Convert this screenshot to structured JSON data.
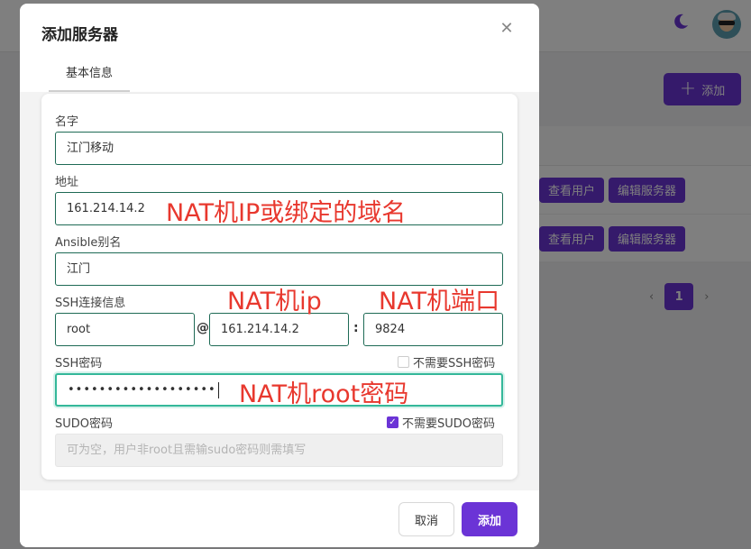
{
  "background": {
    "add_button": "添加",
    "rows": [
      {
        "view_users": "查看用户",
        "edit_server": "编辑服务器"
      },
      {
        "view_users": "查看用户",
        "edit_server": "编辑服务器"
      }
    ],
    "pagination": {
      "prev": "‹",
      "current": "1",
      "next": "›"
    }
  },
  "modal": {
    "title": "添加服务器",
    "tabs": [
      "基本信息"
    ],
    "fields": {
      "name": {
        "label": "名字",
        "value": "江门移动"
      },
      "address": {
        "label": "地址",
        "value": "161.214.14.2"
      },
      "ansible_alias": {
        "label": "Ansible别名",
        "value": "江门"
      },
      "ssh": {
        "label": "SSH连接信息",
        "user": "root",
        "at": "@",
        "host": "161.214.14.2",
        "colon": ":",
        "port": "9824"
      },
      "ssh_password": {
        "label": "SSH密码",
        "value": "•••••••••••••••••••",
        "no_password_label": "不需要SSH密码",
        "no_password_checked": false
      },
      "sudo_password": {
        "label": "SUDO密码",
        "placeholder": "可为空，用户非root且需输sudo密码则需填写",
        "no_password_label": "不需要SUDO密码",
        "no_password_checked": true
      }
    },
    "footer": {
      "cancel": "取消",
      "submit": "添加"
    }
  },
  "annotations": {
    "address": "NAT机IP或绑定的域名",
    "host": "NAT机ip",
    "port": "NAT机端口",
    "password": "NAT机root密码"
  },
  "colors": {
    "accent": "#6b34d6",
    "annotation": "#e8382e",
    "input_border": "#1e6a55",
    "focus": "#34b89a"
  }
}
